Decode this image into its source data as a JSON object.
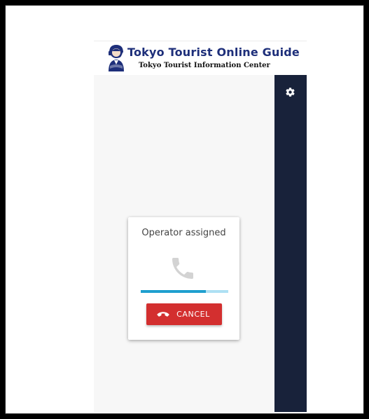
{
  "header": {
    "logo_title": "Tokyo Tourist Online Guide",
    "logo_subtitle": "Tokyo Tourist Information Center",
    "logo_icon": "operator-mascot-icon"
  },
  "sidebar": {
    "settings_icon": "gear-icon",
    "background_color": "#18223a"
  },
  "call_card": {
    "status_text": "Operator assigned",
    "phone_icon": "phone-icon",
    "progress_fraction": 0.74,
    "cancel_label": "CANCEL",
    "cancel_icon": "hang-up-icon",
    "cancel_color": "#d32f2f",
    "progress_color": "#1e9fcf"
  }
}
